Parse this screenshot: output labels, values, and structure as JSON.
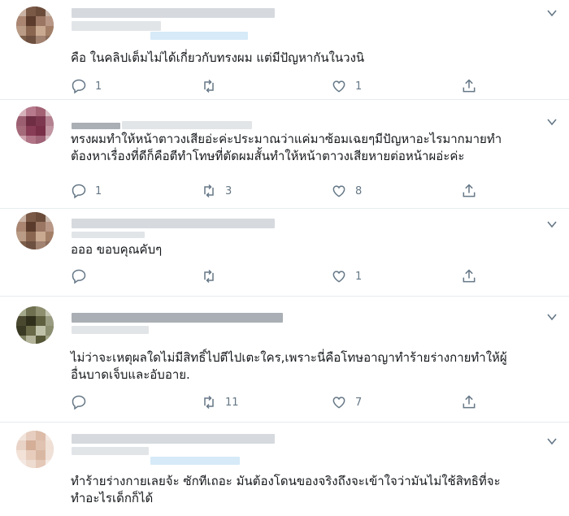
{
  "tweets": [
    {
      "text_lines": [
        "คือ ในคลิปเต็มไม่ได้เกี่ยวกับทรงผม แต่มีปัญหากันในวงนิ"
      ],
      "reply_count": "1",
      "retweet_count": "",
      "like_count": "1"
    },
    {
      "text_lines": [
        "ทรงผมทำให้หน้าตาวงเสียอ่ะค่ะประมาณว่าแค่มาซ้อมเฉยๆมีปัญหาอะไรมากมายทำ",
        "ต้องหาเรื่องที่ดีก็คือตีทำโทษที่ตัดผมสั้นทำให้หน้าตาวงเสียหายต่อหน้าผอ่ะค่ะ"
      ],
      "reply_count": "1",
      "retweet_count": "3",
      "like_count": "8"
    },
    {
      "text_lines": [
        "อออ ขอบคุณคับๆ"
      ],
      "reply_count": "",
      "retweet_count": "",
      "like_count": "1"
    },
    {
      "text_lines": [
        "ไม่ว่าจะเหตุผลใดไม่มีสิทธิ์ไปตีไปเตะใคร,เพราะนี่คือโทษอาญาทำร้ายร่างกายทำให้ผู้",
        "อื่นบาดเจ็บและอับอาย."
      ],
      "reply_count": "",
      "retweet_count": "11",
      "like_count": "7"
    },
    {
      "text_lines": [
        "ทำร้ายร่างกายเลยจ้ะ ซักทีเถอะ มันต้องโดนของจริงถึงจะเข้าใจว่ามันไม่ใช้สิทธิที่จะ",
        "ทำอะไรเด็กก็ได้"
      ],
      "reply_count": "",
      "retweet_count": "",
      "like_count": ""
    }
  ],
  "icons": {
    "reply": "reply-icon",
    "retweet": "retweet-icon",
    "like": "heart-icon",
    "share": "share-icon",
    "menu": "chevron-down-icon"
  },
  "colors": {
    "text": "#14171a",
    "icon": "#657786",
    "divider": "#e6ecf0",
    "blurred_link": "#cfe6f7"
  }
}
